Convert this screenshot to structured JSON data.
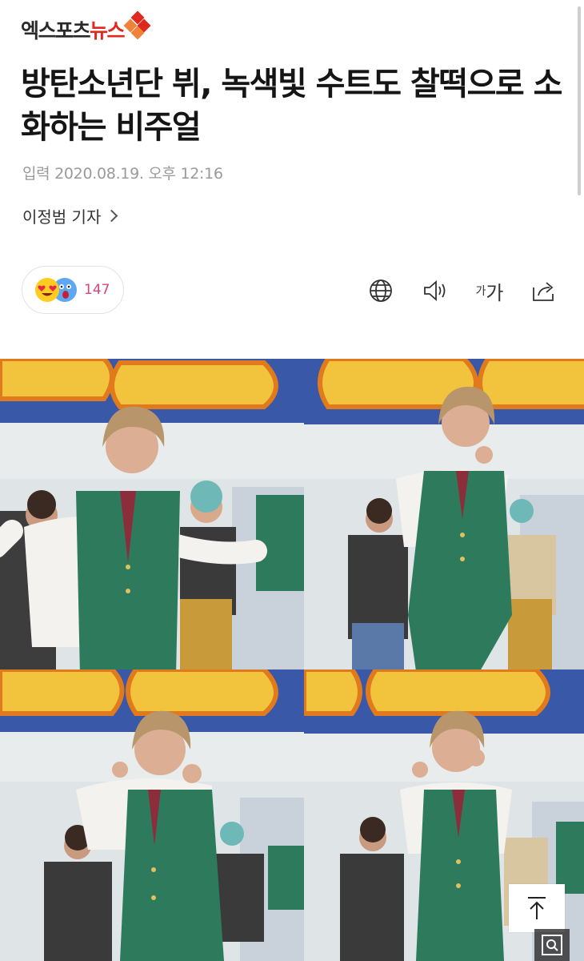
{
  "header": {
    "logo_main": "엑스포츠",
    "logo_accent": "뉴스"
  },
  "article": {
    "title": "방탄소년단 뷔, 녹색빛 수트도 찰떡으로 소화하는 비주얼",
    "date": "입력 2020.08.19. 오후 12:16",
    "reporter": "이정범 기자"
  },
  "reactions": {
    "count": "147",
    "emojis": [
      "heart-eyes-emoji",
      "shocked-emoji"
    ]
  },
  "toolbar": {
    "font_size_small": "가",
    "font_size_large": "가"
  },
  "photo": {
    "frames": [
      "frame-1",
      "frame-2",
      "frame-3",
      "frame-4"
    ],
    "colors": {
      "sky": "#e9eff0",
      "vest": "#2e7a5c",
      "sign": "#f2c33c",
      "sign_stripe": "#3a58a8"
    }
  },
  "controls": {
    "top_icon": "arrow-up-icon",
    "zoom_icon": "magnifier-icon"
  }
}
